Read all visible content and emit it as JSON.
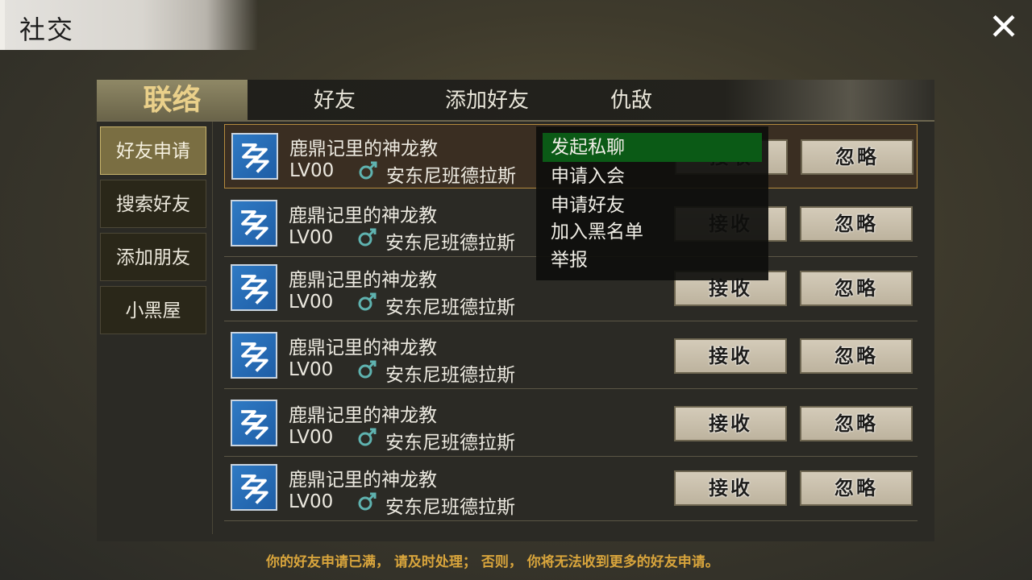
{
  "header": {
    "title": "社交",
    "close_icon": "close-icon"
  },
  "tabs": [
    {
      "label": "联络",
      "active": true
    },
    {
      "label": "好友",
      "active": false
    },
    {
      "label": "添加好友",
      "active": false
    },
    {
      "label": "仇敌",
      "active": false
    }
  ],
  "sidebar": {
    "items": [
      {
        "label": "好友申请",
        "active": true
      },
      {
        "label": "搜索好友",
        "active": false
      },
      {
        "label": "添加朋友",
        "active": false
      },
      {
        "label": "小黑屋",
        "active": false
      }
    ]
  },
  "requests": [
    {
      "name": "鹿鼎记里的神龙教",
      "level": "LV00",
      "gender_icon": "male-icon",
      "server": "安东尼班德拉斯",
      "accept": "接收",
      "ignore": "忽略"
    },
    {
      "name": "鹿鼎记里的神龙教",
      "level": "LV00",
      "gender_icon": "male-icon",
      "server": "安东尼班德拉斯",
      "accept": "接收",
      "ignore": "忽略"
    },
    {
      "name": "鹿鼎记里的神龙教",
      "level": "LV00",
      "gender_icon": "male-icon",
      "server": "安东尼班德拉斯",
      "accept": "接收",
      "ignore": "忽略"
    },
    {
      "name": "鹿鼎记里的神龙教",
      "level": "LV00",
      "gender_icon": "male-icon",
      "server": "安东尼班德拉斯",
      "accept": "接收",
      "ignore": "忽略"
    },
    {
      "name": "鹿鼎记里的神龙教",
      "level": "LV00",
      "gender_icon": "male-icon",
      "server": "安东尼班德拉斯",
      "accept": "接收",
      "ignore": "忽略"
    },
    {
      "name": "鹿鼎记里的神龙教",
      "level": "LV00",
      "gender_icon": "male-icon",
      "server": "安东尼班德拉斯",
      "accept": "接收",
      "ignore": "忽略"
    }
  ],
  "context_menu": {
    "items": [
      {
        "label": "发起私聊",
        "active": true
      },
      {
        "label": "申请入会",
        "active": false
      },
      {
        "label": "申请好友",
        "active": false
      },
      {
        "label": "加入黑名单",
        "active": false
      },
      {
        "label": "举报",
        "active": false
      }
    ]
  },
  "footer": {
    "notice": "你的好友申请已满， 请及时处理； 否则， 你将无法收到更多的好友申请。"
  },
  "colors": {
    "accent_gold": "#ead08a",
    "menu_highlight": "#0b5a16",
    "notice": "#d9a53c",
    "gender_male": "#5fb3b0"
  }
}
